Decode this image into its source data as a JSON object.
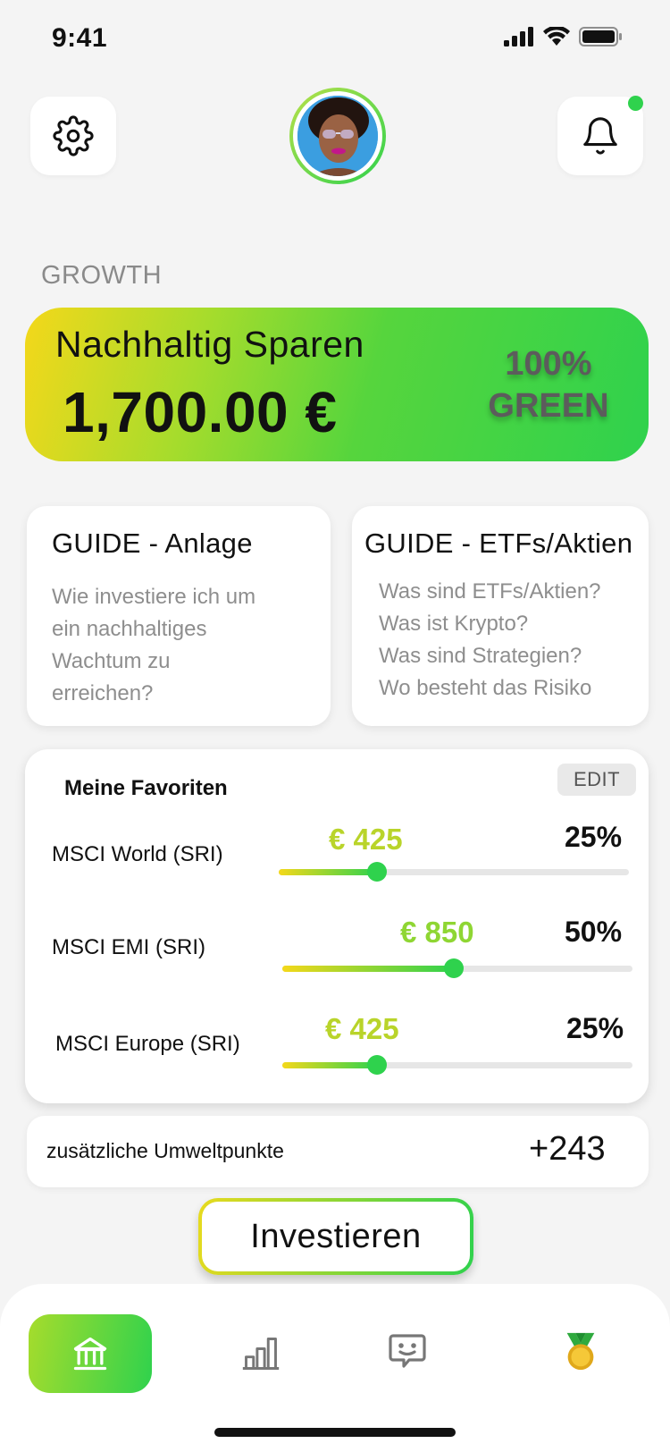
{
  "status": {
    "time": "9:41"
  },
  "section_label": "GROWTH",
  "savings_card": {
    "title": "Nachhaltig Sparen",
    "amount": "1,700.00 €",
    "badge_line1": "100%",
    "badge_line2": "GREEN"
  },
  "guides": [
    {
      "title": "GUIDE - Anlage",
      "lines": [
        "Wie investiere ich um",
        "ein nachhaltiges",
        "Wachtum zu",
        "erreichen?"
      ]
    },
    {
      "title": "GUIDE - ETFs/Aktien",
      "lines": [
        "Was sind ETFs/Aktien?",
        "Was ist Krypto?",
        "Was sind Strategien?",
        "Wo besteht das Risiko"
      ]
    }
  ],
  "favorites": {
    "title": "Meine Favoriten",
    "edit_label": "EDIT",
    "items": [
      {
        "name": "MSCI World (SRI)",
        "amount": "€ 425",
        "percent": "25%",
        "level": 0.28
      },
      {
        "name": "MSCI EMI (SRI)",
        "amount": "€ 850",
        "percent": "50%",
        "level": 0.49
      },
      {
        "name": "MSCI Europe (SRI)",
        "amount": "€ 425",
        "percent": "25%",
        "level": 0.27
      }
    ]
  },
  "points": {
    "label": "zusätzliche Umweltpunkte",
    "value": "+243"
  },
  "invest_label": "Investieren",
  "colors": {
    "accent_green": "#2fd24d",
    "accent_yellow": "#f4d81a",
    "amount_green": "#7cd83a",
    "amount_yellow": "#b4d22a"
  },
  "tabs": [
    {
      "icon": "bank-icon",
      "active": true
    },
    {
      "icon": "bar-chart-icon",
      "active": false
    },
    {
      "icon": "chat-face-icon",
      "active": false
    },
    {
      "icon": "medal-icon",
      "active": false
    }
  ]
}
